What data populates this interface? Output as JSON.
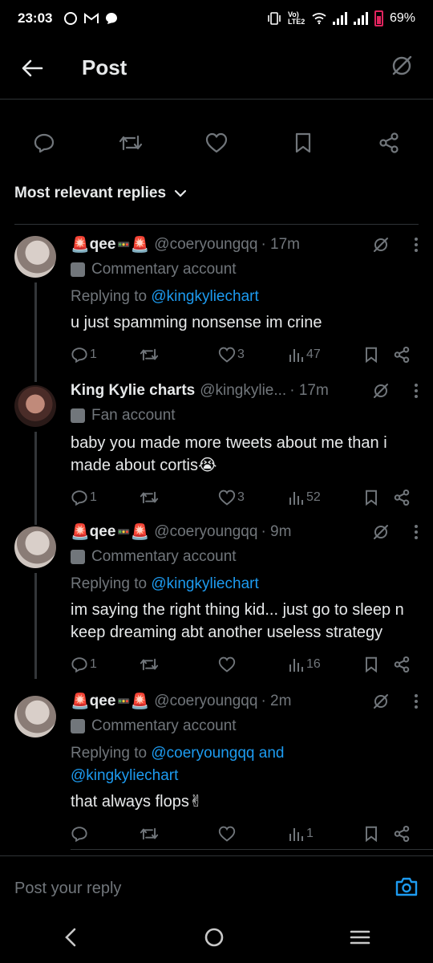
{
  "status_bar": {
    "time": "23:03",
    "network_label": "Vo) LTE2",
    "battery": "69%"
  },
  "header": {
    "title": "Post"
  },
  "sort": {
    "label": "Most relevant replies"
  },
  "replies": [
    {
      "name": "qee",
      "handle": "@coeryoungqq",
      "time": "· 17m",
      "label": "Commentary account",
      "replying_prefix": "Replying to ",
      "replying_to": "@kingkyliechart",
      "text": "u just spamming nonsense im crine",
      "replies": "1",
      "retweets": "",
      "likes": "3",
      "views": "47"
    },
    {
      "name": "King Kylie charts",
      "handle": "@kingkylie...",
      "time": "· 17m",
      "label": "Fan account",
      "text": "baby you made more tweets about me than i made about cortis😭",
      "replies": "1",
      "retweets": "",
      "likes": "3",
      "views": "52"
    },
    {
      "name": "qee",
      "handle": "@coeryoungqq",
      "time": "· 9m",
      "label": "Commentary account",
      "replying_prefix": "Replying to ",
      "replying_to": "@kingkyliechart",
      "text": "im saying the right thing kid... just go to sleep n keep dreaming abt another useless strategy",
      "replies": "1",
      "retweets": "",
      "likes": "",
      "views": "16"
    },
    {
      "name": "qee",
      "handle": "@coeryoungqq",
      "time": "· 2m",
      "label": "Commentary account",
      "replying_prefix": "Replying to ",
      "replying_to": "@coeryoungqq and @kingkyliechart",
      "text": "that always flops✌",
      "replies": "",
      "retweets": "",
      "likes": "",
      "views": "1"
    }
  ],
  "compose": {
    "placeholder": "Post your reply"
  },
  "colors": {
    "background": "#000000",
    "text": "#e7e9ea",
    "muted": "#71767b",
    "link": "#1d9bf0",
    "divider": "#2f3336"
  },
  "icons": [
    "back-arrow-icon",
    "grok-icon",
    "reply-icon",
    "retweet-icon",
    "like-icon",
    "bookmark-icon",
    "share-icon",
    "chevron-down-icon",
    "more-icon",
    "views-icon",
    "camera-icon"
  ]
}
